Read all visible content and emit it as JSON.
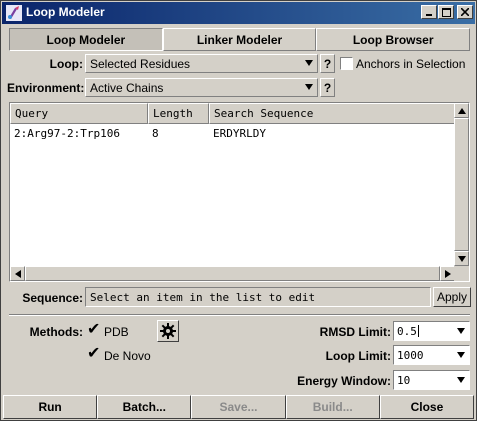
{
  "window": {
    "title": "Loop Modeler",
    "icon": "chimera-app-icon"
  },
  "tabs": [
    {
      "label": "Loop Modeler",
      "active": true
    },
    {
      "label": "Linker Modeler",
      "active": false
    },
    {
      "label": "Loop Browser",
      "active": false
    }
  ],
  "loop": {
    "label": "Loop:",
    "value": "Selected Residues",
    "help": "?",
    "anchors_label": "Anchors in Selection",
    "anchors_checked": false
  },
  "environment": {
    "label": "Environment:",
    "value": "Active Chains",
    "help": "?"
  },
  "table": {
    "columns": [
      "Query",
      "Length",
      "Search Sequence"
    ],
    "rows": [
      {
        "query": "2:Arg97-2:Trp106",
        "length": "8",
        "sequence": "ERDYRLDY"
      }
    ]
  },
  "sequence": {
    "label": "Sequence:",
    "placeholder": "Select an item in the list to edit",
    "apply_label": "Apply"
  },
  "methods": {
    "label": "Methods:",
    "pdb_label": "PDB",
    "pdb_checked": true,
    "denovo_label": "De Novo",
    "denovo_checked": true,
    "settings_icon": "gear-icon"
  },
  "params": {
    "rmsd_label": "RMSD Limit:",
    "rmsd_value": "0.5",
    "loop_label": "Loop Limit:",
    "loop_value": "1000",
    "energy_label": "Energy Window:",
    "energy_value": "10"
  },
  "buttons": {
    "run": "Run",
    "batch": "Batch...",
    "save": "Save...",
    "build": "Build...",
    "close": "Close"
  }
}
